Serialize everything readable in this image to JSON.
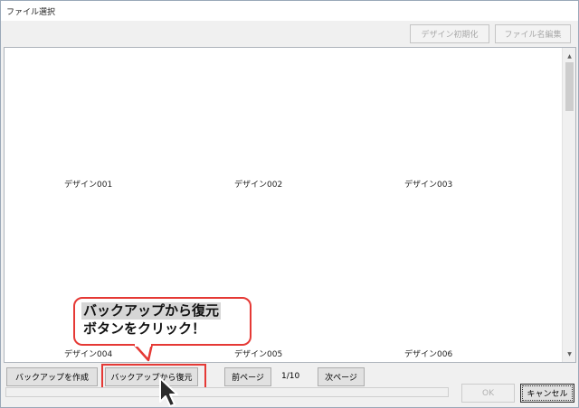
{
  "window": {
    "title": "ファイル選択"
  },
  "toolbar": {
    "reset_label": "デザイン初期化",
    "rename_label": "ファイル名編集"
  },
  "grid": {
    "items": [
      {
        "label": "デザイン001"
      },
      {
        "label": "デザイン002"
      },
      {
        "label": "デザイン003"
      },
      {
        "label": "デザイン004"
      },
      {
        "label": "デザイン005"
      },
      {
        "label": "デザイン006"
      }
    ]
  },
  "footer": {
    "backup_label": "バックアップを作成",
    "restore_label": "バックアップから復元",
    "prev_label": "前ページ",
    "page_indicator": "1/10",
    "next_label": "次ページ",
    "ok_label": "OK",
    "cancel_label": "キャンセル"
  },
  "callout": {
    "line1": "バックアップから復元",
    "line2": "ボタンをクリック！"
  },
  "colors": {
    "highlight": "#e53935",
    "window_bg": "#f0f0f0"
  },
  "icons": {
    "scroll_up": "chevron-up-icon",
    "scroll_down": "chevron-down-icon",
    "cursor": "mouse-pointer-icon"
  }
}
